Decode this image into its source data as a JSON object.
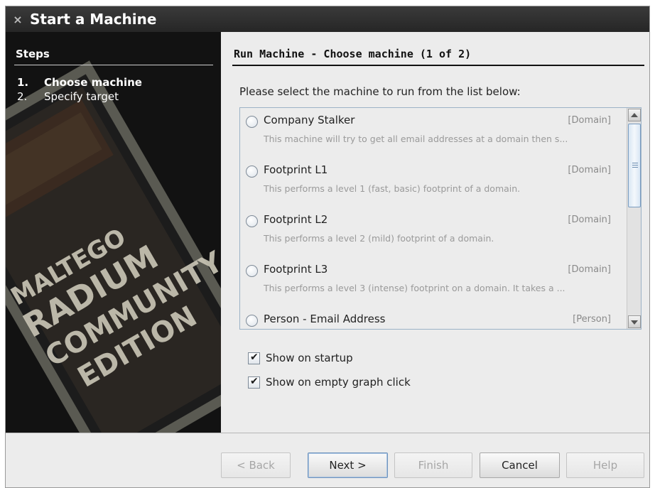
{
  "window": {
    "title": "Start a Machine",
    "close_glyph": "×"
  },
  "sidebar": {
    "heading": "Steps",
    "steps": [
      {
        "num": "1.",
        "label": "Choose machine",
        "active": true
      },
      {
        "num": "2.",
        "label": "Specify target",
        "active": false
      }
    ],
    "art_words": [
      "MALTEGO",
      "RADIUM",
      "COMMUNITY",
      "EDITION"
    ]
  },
  "main": {
    "heading": "Run Machine - Choose machine (1 of 2)",
    "prompt": "Please select the machine to run from the list below:",
    "machines": [
      {
        "name": "Company Stalker",
        "tag": "[Domain]",
        "desc": "This machine will try to get all email addresses at a domain then s..."
      },
      {
        "name": "Footprint L1",
        "tag": "[Domain]",
        "desc": "This performs a level 1 (fast, basic) footprint of a domain."
      },
      {
        "name": "Footprint L2",
        "tag": "[Domain]",
        "desc": "This performs a level 2 (mild) footprint of a domain."
      },
      {
        "name": "Footprint L3",
        "tag": "[Domain]",
        "desc": "This performs a level 3 (intense) footprint on a domain. It takes a ..."
      },
      {
        "name": "Person - Email Address",
        "tag": "[Person]",
        "desc": ""
      }
    ],
    "options": [
      {
        "label": "Show on startup",
        "checked": true
      },
      {
        "label": "Show on empty graph click",
        "checked": true
      }
    ]
  },
  "buttons": {
    "back": "< Back",
    "next": "Next >",
    "finish": "Finish",
    "cancel": "Cancel",
    "help": "Help"
  },
  "colors": {
    "titlebar": "#2e2e2e",
    "sidebar": "#141414",
    "panel": "#ececec",
    "list_border": "#9cb2c6"
  }
}
